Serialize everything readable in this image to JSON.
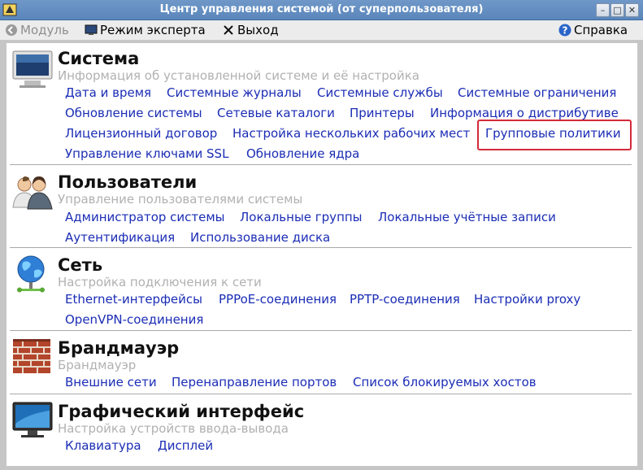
{
  "window": {
    "title": "Центр управления системой (от суперпользователя)",
    "controls": {
      "minimize": "–",
      "maximize": "□",
      "close": "✕"
    }
  },
  "toolbar": {
    "module_label": "Модуль",
    "expert_label": "Режим эксперта",
    "exit_label": "Выход",
    "help_label": "Справка"
  },
  "sections": {
    "system": {
      "title": "Система",
      "subtitle": "Информация об установленной системе и её настройка",
      "links": [
        "Дата и время",
        "Системные журналы",
        "Системные службы",
        "Системные ограничения",
        "Обновление системы",
        "Сетевые каталоги",
        "Принтеры",
        "Информация о дистрибутиве",
        "Лицензионный договор",
        "Настройка нескольких рабочих мест",
        "Групповые политики",
        "Управление ключами SSL",
        "Обновление ядра"
      ]
    },
    "users": {
      "title": "Пользователи",
      "subtitle": "Управление пользователями системы",
      "links": [
        "Администратор системы",
        "Локальные группы",
        "Локальные учётные записи",
        "Аутентификация",
        "Использование диска"
      ]
    },
    "network": {
      "title": "Сеть",
      "subtitle": "Настройка подключения к сети",
      "links": [
        "Ethernet-интерфейсы",
        "PPPoE-соединения",
        "PPTP-соединения",
        "Настройки proxy",
        "OpenVPN-соединения"
      ]
    },
    "firewall": {
      "title": "Брандмауэр",
      "subtitle": "Брандмауэр",
      "links": [
        "Внешние сети",
        "Перенаправление портов",
        "Список блокируемых хостов"
      ]
    },
    "gui": {
      "title": "Графический интерфейс",
      "subtitle": "Настройка устройств ввода-вывода",
      "links": [
        "Клавиатура",
        "Дисплей"
      ]
    }
  },
  "colors": {
    "link": "#1b2db5",
    "highlight": "#d42a3b",
    "titlebar": "#5b86bb"
  },
  "icons": [
    "app-icon",
    "module-icon",
    "monitor-icon",
    "exit-icon",
    "help-icon",
    "system-monitor-icon",
    "users-icon",
    "globe-network-icon",
    "brick-wall-icon",
    "display-screen-icon"
  ]
}
